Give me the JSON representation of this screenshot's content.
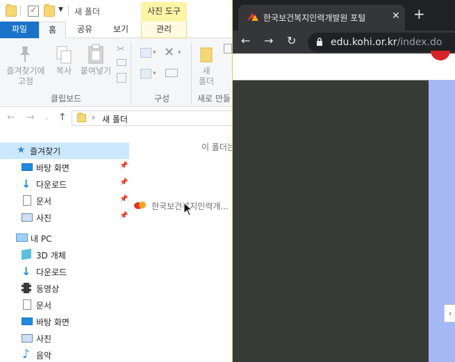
{
  "explorer": {
    "window_title": "새 폴더",
    "contextual_tool_tab": "사진 도구",
    "ribbon_tabs": {
      "file": "파일",
      "home": "홈",
      "share": "공유",
      "view": "보기",
      "manage": "관리"
    },
    "ribbon": {
      "pin_label": "즐겨찾기에\n고정",
      "copy_label": "복사",
      "paste_label": "붙여넣기",
      "new_folder_label": "새\n폴더",
      "group_clipboard": "클립보드",
      "group_organize": "구성",
      "group_new": "새로 만들"
    },
    "address": {
      "path": "새 폴더"
    },
    "nav": {
      "quick_access": "즐겨찾기",
      "desktop": "바탕 화면",
      "downloads": "다운로드",
      "documents": "문서",
      "pictures": "사진",
      "this_pc": "내 PC",
      "objects3d": "3D 개체",
      "pc_downloads": "다운로드",
      "videos": "동영상",
      "pc_documents": "문서",
      "pc_desktop": "바탕 화면",
      "pc_pictures": "사진",
      "music": "음악"
    },
    "file_pane": {
      "empty_message": "이 폴더는",
      "drag_item_label": "한국보건복지인력개..."
    }
  },
  "browser": {
    "tab_title": "한국보건복지인력개발원 포털",
    "url_domain": "edu.kohi.or.kr",
    "url_path": "/index.do"
  },
  "colors": {
    "file_tab": "#1a73c9",
    "tool_tab": "#fbf5a5",
    "nav_selected": "#cce8ff",
    "chrome_tabbar": "#202124",
    "chrome_toolbar": "#35363a",
    "page_dark": "#373b38",
    "page_blue": "#a6b7f5"
  }
}
